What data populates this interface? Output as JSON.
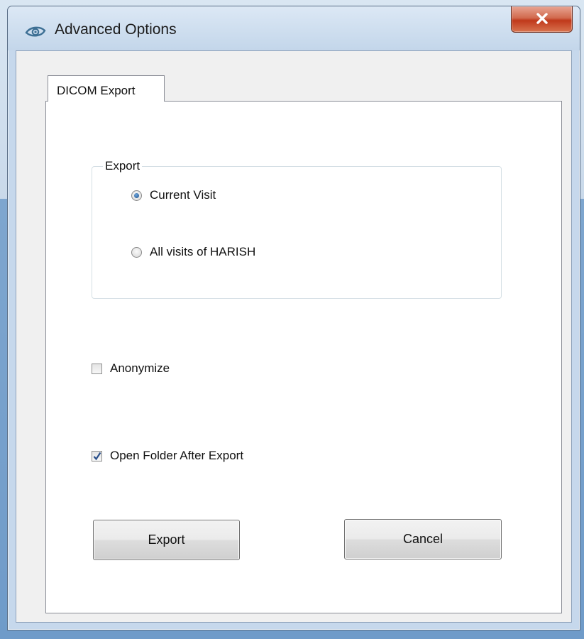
{
  "window": {
    "title": "Advanced Options",
    "icon": "eye-icon",
    "close_label": "x"
  },
  "tabs": [
    {
      "label": "DICOM Export",
      "selected": true
    }
  ],
  "export_group": {
    "legend": "Export",
    "options": [
      {
        "label": "Current Visit",
        "selected": true
      },
      {
        "label": "All visits of HARISH",
        "selected": false
      }
    ]
  },
  "checkboxes": {
    "anonymize": {
      "label": "Anonymize",
      "checked": false
    },
    "open_folder": {
      "label": "Open Folder After Export",
      "checked": true
    }
  },
  "buttons": {
    "export": "Export",
    "cancel": "Cancel"
  },
  "colors": {
    "accent": "#1c4f8a",
    "close_button": "#c0391b",
    "titlebar": "#c6d8ec"
  }
}
